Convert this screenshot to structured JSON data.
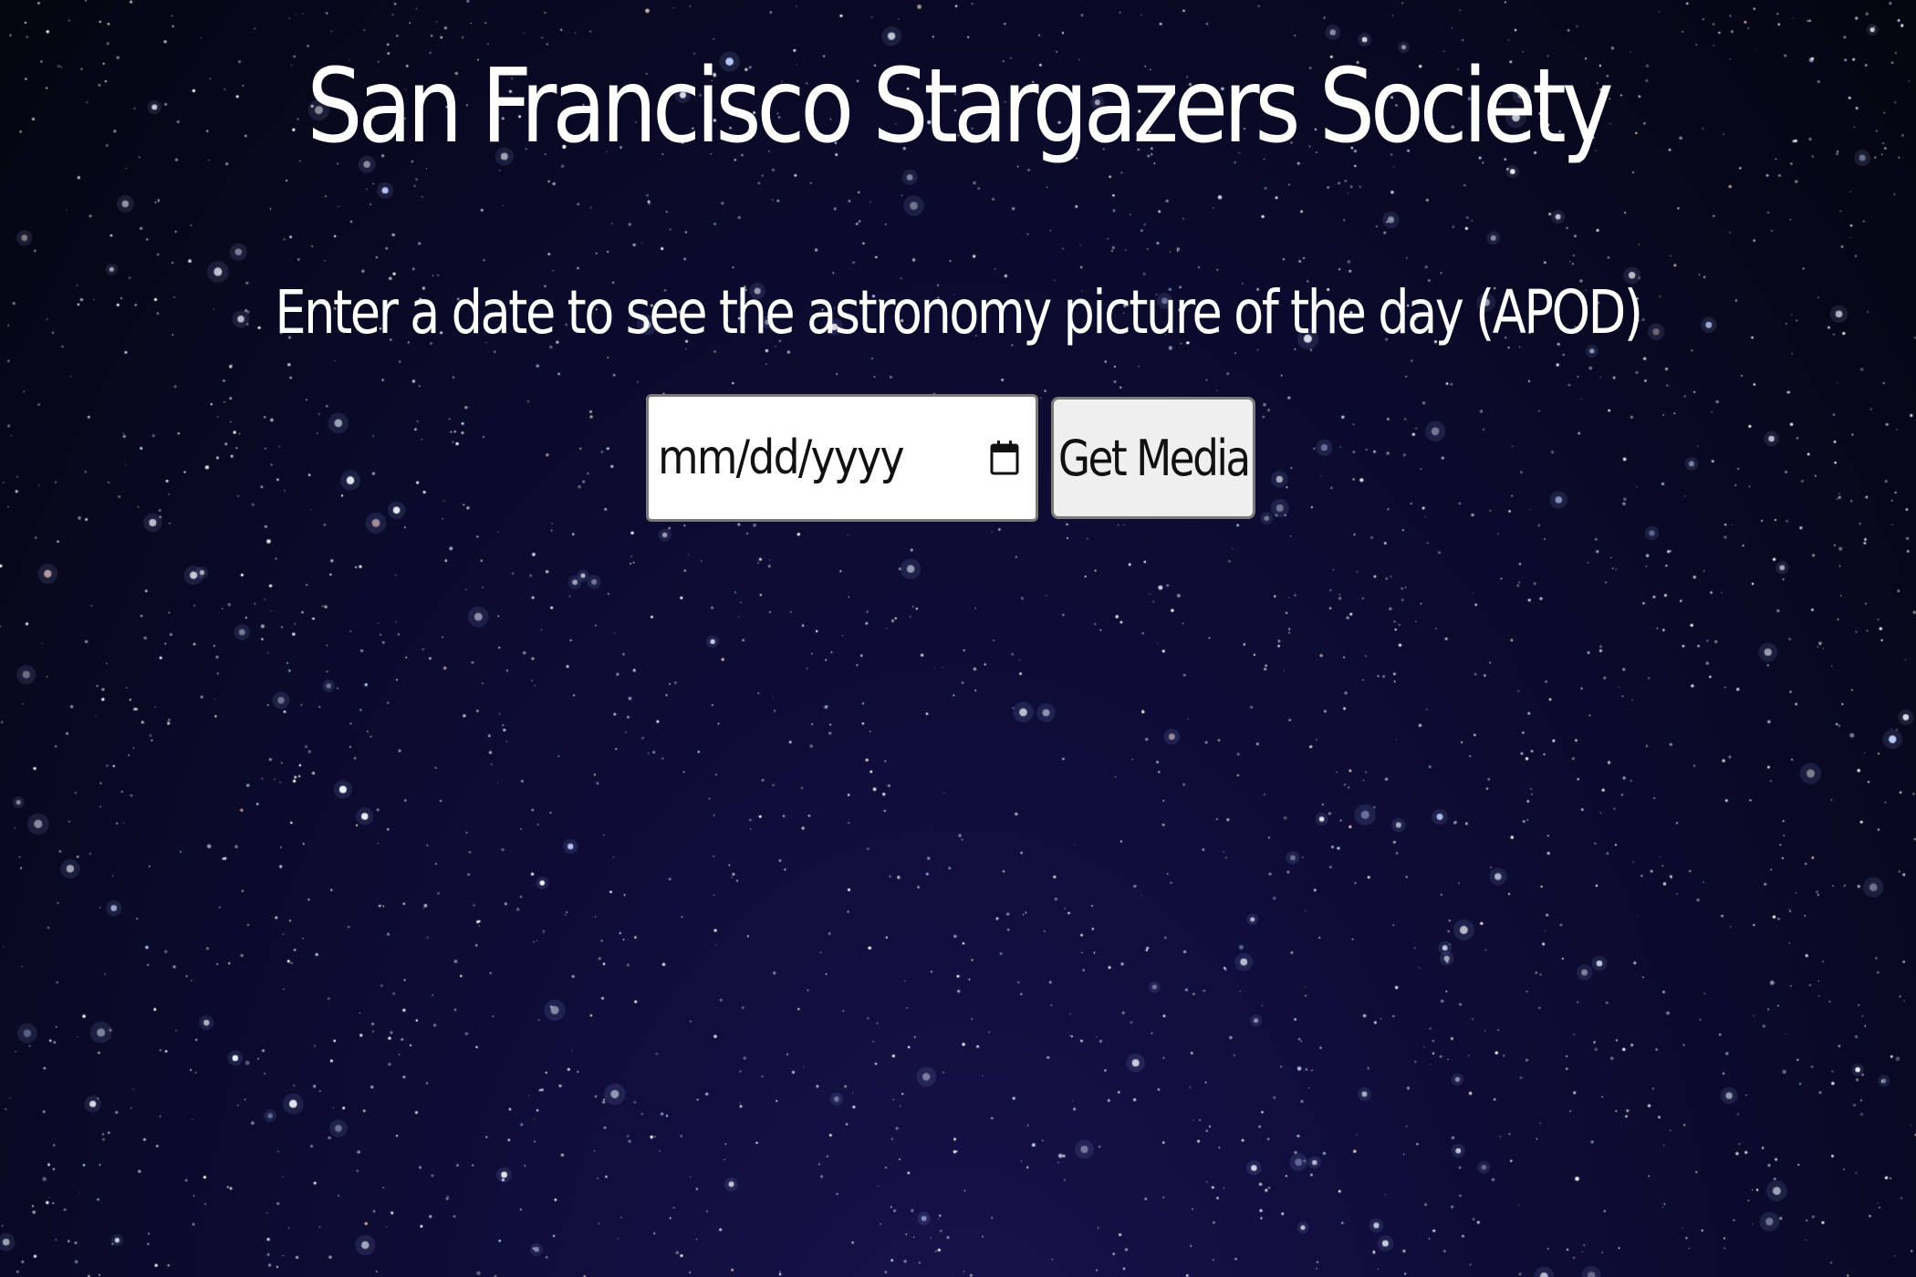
{
  "page": {
    "title": "San Francisco Stargazers Society",
    "subtitle": "Enter a date to see the astronomy picture of the day (APOD)"
  },
  "form": {
    "date_input": {
      "placeholder": "mm/dd/yyyy",
      "value": "",
      "icon": "calendar-icon"
    },
    "submit_label": "Get Media"
  },
  "theme": {
    "background": "#0a0a2a",
    "text_color": "#ffffff",
    "button_bg": "#efefef"
  }
}
